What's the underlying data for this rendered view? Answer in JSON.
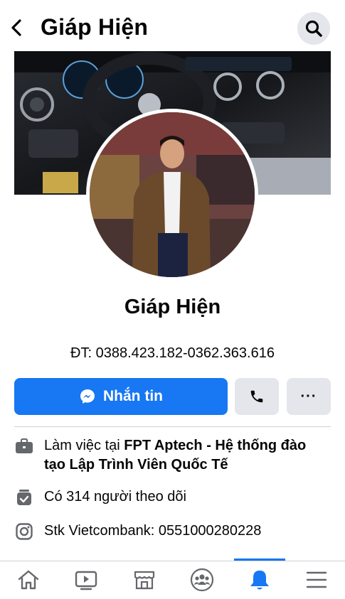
{
  "header": {
    "title": "Giáp Hiện"
  },
  "profile": {
    "name": "Giáp Hiện",
    "bio": "ĐT: 0388.423.182-0362.363.616"
  },
  "actions": {
    "message_label": "Nhắn tin",
    "more_label": "···"
  },
  "details": {
    "work_prefix": "Làm việc tại ",
    "work_place": "FPT Aptech - Hệ thống đào tạo Lập Trình Viên Quốc Tế",
    "followers": "Có 314 người theo dõi",
    "instagram": "Stk Vietcombank: 0551000280228"
  },
  "bottom_nav": {
    "items": [
      "home-icon",
      "watch-icon",
      "marketplace-icon",
      "groups-icon",
      "notifications-icon",
      "menu-icon"
    ],
    "active": "notifications-icon"
  },
  "colors": {
    "accent": "#1877f2",
    "button_gray": "#e4e6eb",
    "text": "#050505"
  }
}
